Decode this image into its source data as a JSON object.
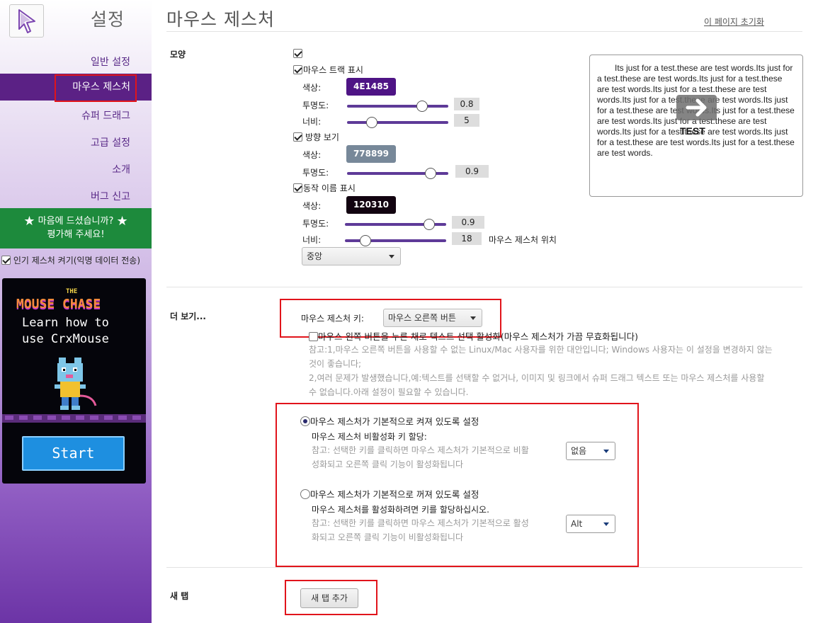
{
  "sidebar": {
    "title": "설정",
    "nav": [
      {
        "label": "일반 설정"
      },
      {
        "label": "마우스 제스처"
      },
      {
        "label": "슈퍼 드래그"
      },
      {
        "label": "고급 설정"
      },
      {
        "label": "소개"
      },
      {
        "label": "버그 신고"
      }
    ],
    "rate_line1": "마음에 드셨습니까?",
    "rate_line2": "평가해 주세요!",
    "popular_label": "인기 제스처 켜기(익명 데이터 전송)",
    "ad": {
      "the": "THE",
      "brand": "MOUSE CHASE",
      "text": "Learn how to use CrxMouse",
      "start": "Start"
    }
  },
  "header": {
    "title": "마우스 제스처",
    "reset_link": "이 페이지 초기화"
  },
  "appearance": {
    "label": "모양",
    "track": {
      "label": "마우스 트랙 표시",
      "color_label": "색상:",
      "color": "4E1485",
      "opacity_label": "투명도:",
      "opacity": "0.8",
      "width_label": "너비:",
      "width": "5"
    },
    "direction": {
      "label": "방향 보기",
      "color_label": "색상:",
      "color": "778899",
      "opacity_label": "투명도:",
      "opacity": "0.9"
    },
    "action": {
      "label": "동작 이름 표시",
      "color_label": "색상:",
      "color": "120310",
      "opacity_label": "투명도:",
      "opacity": "0.9",
      "width_label": "너비:",
      "width": "18",
      "position_label": "마우스 제스처 위치",
      "position_value": "중앙"
    },
    "preview_text": "Its just for a test.these are test words.Its just for a test.these are test words.Its just for a test.these are test words.Its just for a test.these are test words.Its just for a test.these are test words.Its just for a test.these are test words.Its just for a test.these are test words.Its just for a test.these are test words.Its just for a test.these are test words.Its just for a test.these are test words.Its just for a test.these are test words.",
    "preview_label": "TEST"
  },
  "more": {
    "label": "더 보기...",
    "key_label": "마우스 제스처 키:",
    "key_value": "마우스 오른쪽 버튼",
    "left_button_label": "마우스 왼쪽 버튼을 누른 채로 텍스트 선택 활성화(마우스 제스처가 가끔 무효화됩니다)",
    "note1_line1": "참고:1,마우스 오른쪽 버튼을 사용할 수 없는 Linux/Mac 사용자를 위한 대안입니다; Windows 사용자는 이 설정을 변경하지 않는",
    "note1_line2": "것이 좋습니다;",
    "note2_line1": "2,여러 문제가 발생했습니다,예:텍스트를 선택할 수 없거나, 이미지 및 링크에서 슈퍼 드래그 텍스트 또는 마우스 제스처를 사용할",
    "note2_line2": "수 없습니다.아래 설정이 필요할 수 있습니다.",
    "option_on": {
      "label": "마우스 제스처가 기본적으로 켜져 있도록 설정",
      "sub": "마우스 제스처 비활성화 키 할당:",
      "note_line1": "참고: 선택한 키를 클릭하면 마우스 제스처가 기본적으로 비활",
      "note_line2": "성화되고 오른쪽 클릭 기능이 활성화됩니다",
      "key": "없음"
    },
    "option_off": {
      "label": "마우스 제스처가 기본적으로 꺼져 있도록 설정",
      "sub": "마우스 제스처를 활성화하려면 키를 할당하십시오.",
      "note_line1": "참고: 선택한 키를 클릭하면 마우스 제스처가 기본적으로 활성",
      "note_line2": "화되고 오른쪽 클릭 기능이 비활성화됩니다",
      "key": "Alt"
    }
  },
  "new_tab": {
    "label": "새 탭",
    "button": "새 탭 추가"
  },
  "colors": {
    "accent": "#5b2185",
    "green": "#1d8a3c",
    "annotation_red": "#e1141b"
  }
}
